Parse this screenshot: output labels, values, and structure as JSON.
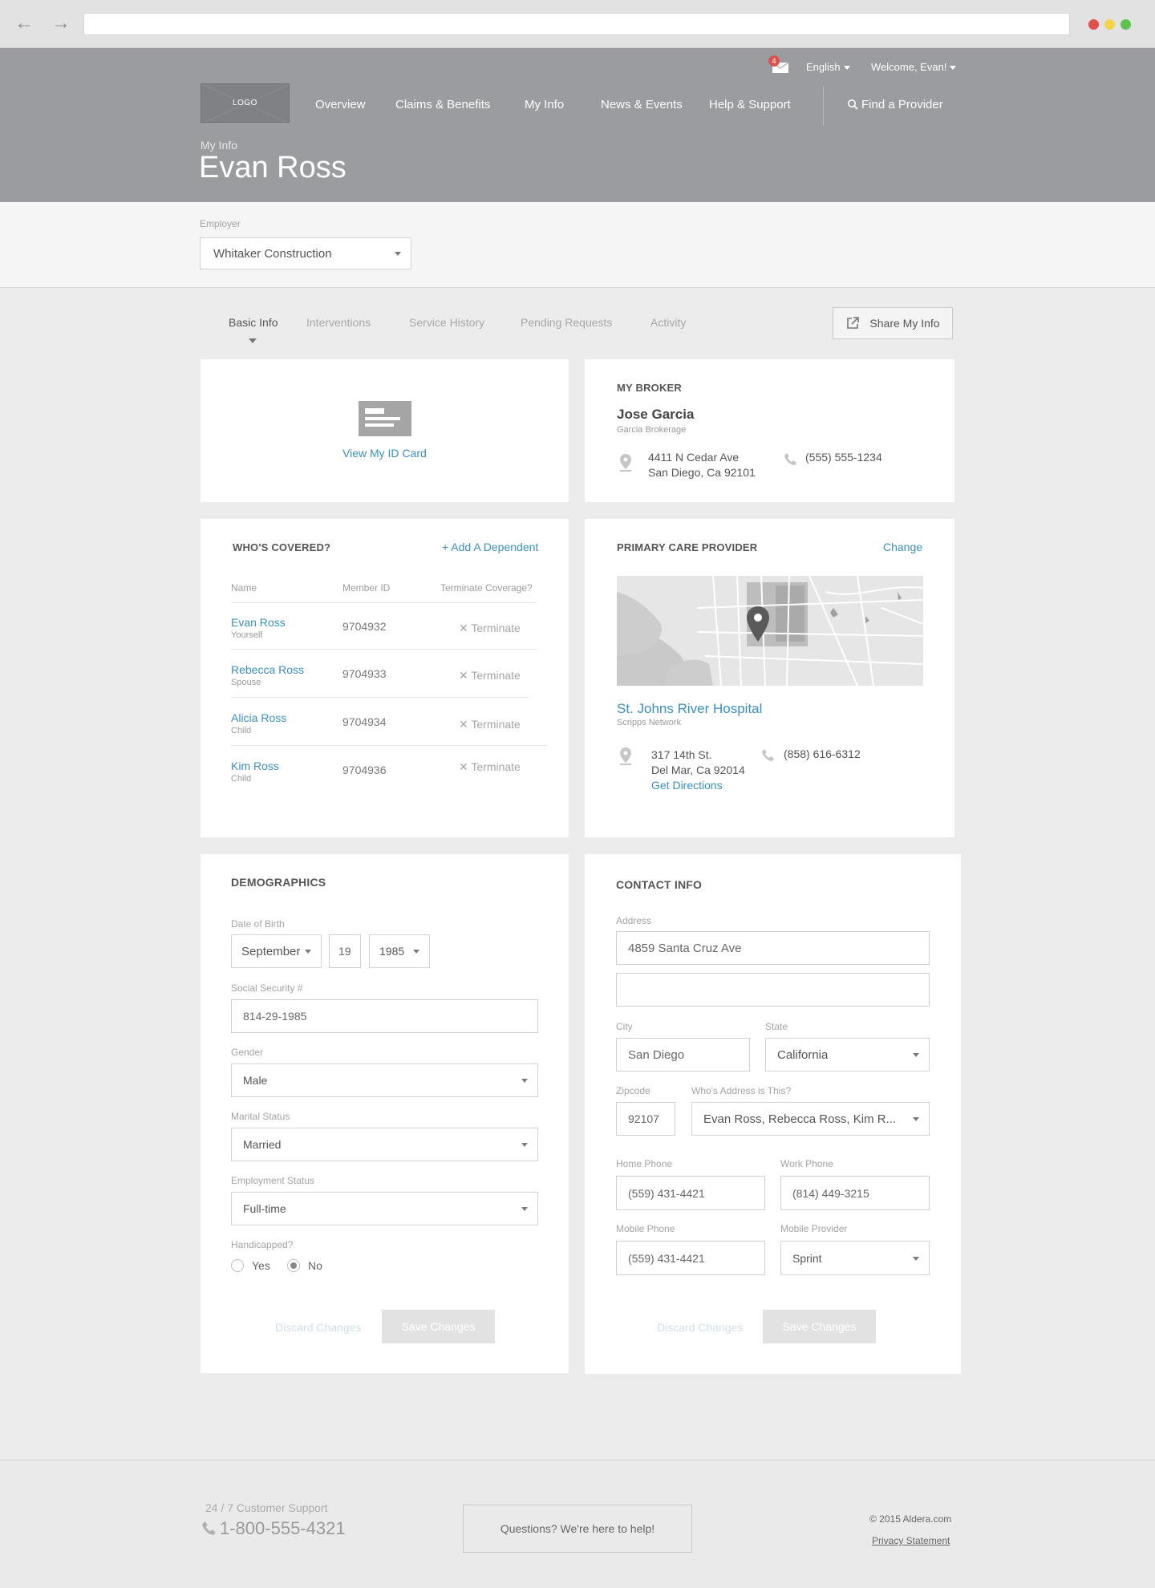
{
  "header": {
    "notification_count": "4",
    "language": "English",
    "welcome": "Welcome, Evan!",
    "logo": "LOGO",
    "nav": [
      "Overview",
      "Claims & Benefits",
      "My Info",
      "News & Events",
      "Help & Support"
    ],
    "find_provider": "Find a Provider",
    "breadcrumb": "My Info",
    "title": "Evan Ross"
  },
  "employer": {
    "label": "Employer",
    "value": "Whitaker Construction"
  },
  "tabs": [
    "Basic Info",
    "Interventions",
    "Service History",
    "Pending Requests",
    "Activity"
  ],
  "share_button": "Share My Info",
  "id_card": {
    "link": "View My ID Card"
  },
  "broker": {
    "heading": "MY BROKER",
    "name": "Jose Garcia",
    "company": "Garcia Brokerage",
    "address1": "4411 N Cedar Ave",
    "address2": "San Diego, Ca 92101",
    "phone": "(555) 555-1234"
  },
  "covered": {
    "heading": "WHO'S COVERED?",
    "add_link": "+ Add A Dependent",
    "columns": [
      "Name",
      "Member ID",
      "Terminate Coverage?"
    ],
    "rows": [
      {
        "name": "Evan Ross",
        "relation": "Yourself",
        "id": "9704932",
        "action": "Terminate"
      },
      {
        "name": "Rebecca Ross",
        "relation": "Spouse",
        "id": "9704933",
        "action": "Terminate"
      },
      {
        "name": "Alicia Ross",
        "relation": "Child",
        "id": "9704934",
        "action": "Terminate"
      },
      {
        "name": "Kim Ross",
        "relation": "Child",
        "id": "9704936",
        "action": "Terminate"
      }
    ]
  },
  "pcp": {
    "heading": "PRIMARY CARE PROVIDER",
    "change": "Change",
    "name": "St. Johns River Hospital",
    "network": "Scripps Network",
    "address1": "317 14th St.",
    "address2": "Del Mar, Ca 92014",
    "directions": "Get Directions",
    "phone": "(858) 616-6312"
  },
  "demographics": {
    "heading": "DEMOGRAPHICS",
    "dob_label": "Date of Birth",
    "dob_month": "September",
    "dob_day": "19",
    "dob_year": "1985",
    "ssn_label": "Social Security #",
    "ssn": "814-29-1985",
    "gender_label": "Gender",
    "gender": "Male",
    "marital_label": "Marital Status",
    "marital": "Married",
    "employment_label": "Employment Status",
    "employment": "Full-time",
    "handicapped_label": "Handicapped?",
    "yes": "Yes",
    "no": "No",
    "handicapped_value": "No",
    "discard": "Discard Changes",
    "save": "Save Changes"
  },
  "contact": {
    "heading": "CONTACT INFO",
    "address_label": "Address",
    "address1": "4859 Santa Cruz Ave",
    "address2": "",
    "city_label": "City",
    "city": "San Diego",
    "state_label": "State",
    "state": "California",
    "zip_label": "Zipcode",
    "zip": "92107",
    "whose_label": "Who's Address is This?",
    "whose": "Evan Ross, Rebecca Ross, Kim R...",
    "home_label": "Home Phone",
    "home": "(559) 431-4421",
    "work_label": "Work Phone",
    "work": "(814) 449-3215",
    "mobile_label": "Mobile Phone",
    "mobile": "(559) 431-4421",
    "provider_label": "Mobile Provider",
    "provider": "Sprint",
    "discard": "Discard Changes",
    "save": "Save Changes"
  },
  "footer": {
    "support_label": "24 / 7 Customer Support",
    "phone": "1-800-555-4321",
    "help_button": "Questions? We're here to help!",
    "copyright": "© 2015 Aldera.com",
    "privacy": "Privacy Statement"
  },
  "colors": {
    "accent": "#3a8fc1",
    "header": "#9a9c9f",
    "badge": "#d9534f"
  }
}
